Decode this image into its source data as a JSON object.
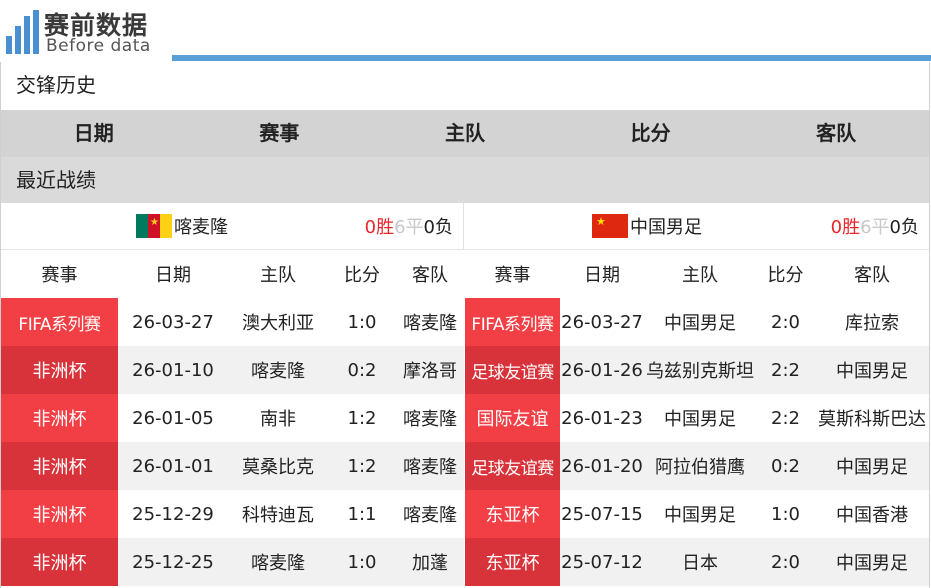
{
  "brand": {
    "title": "赛前数据",
    "subtitle": "Before data",
    "accent": "#5aa0d8"
  },
  "section_h2h": "交锋历史",
  "h2h_columns": [
    "日期",
    "赛事",
    "主队",
    "比分",
    "客队"
  ],
  "section_recent": "最近战绩",
  "left": {
    "team": "喀麦隆",
    "flag": "cameroon-flag",
    "record": {
      "w": "0胜",
      "d": "6平",
      "l": "0负"
    },
    "columns": [
      "赛事",
      "日期",
      "主队",
      "比分",
      "客队"
    ],
    "rows": [
      [
        "FIFA系列赛",
        "26-03-27",
        "澳大利亚",
        "1:0",
        "喀麦隆"
      ],
      [
        "非洲杯",
        "26-01-10",
        "喀麦隆",
        "0:2",
        "摩洛哥"
      ],
      [
        "非洲杯",
        "26-01-05",
        "南非",
        "1:2",
        "喀麦隆"
      ],
      [
        "非洲杯",
        "26-01-01",
        "莫桑比克",
        "1:2",
        "喀麦隆"
      ],
      [
        "非洲杯",
        "25-12-29",
        "科特迪瓦",
        "1:1",
        "喀麦隆"
      ],
      [
        "非洲杯",
        "25-12-25",
        "喀麦隆",
        "1:0",
        "加蓬"
      ]
    ]
  },
  "right": {
    "team": "中国男足",
    "flag": "china-flag",
    "record": {
      "w": "0胜",
      "d": "6平",
      "l": "0负"
    },
    "columns": [
      "赛事",
      "日期",
      "主队",
      "比分",
      "客队"
    ],
    "rows": [
      [
        "FIFA系列赛",
        "26-03-27",
        "中国男足",
        "2:0",
        "库拉索"
      ],
      [
        "足球友谊赛",
        "26-01-26",
        "乌兹别克斯坦",
        "2:2",
        "中国男足"
      ],
      [
        "国际友谊",
        "26-01-23",
        "中国男足",
        "2:2",
        "莫斯科斯巴达"
      ],
      [
        "足球友谊赛",
        "26-01-20",
        "阿拉伯猎鹰",
        "0:2",
        "中国男足"
      ],
      [
        "东亚杯",
        "25-07-15",
        "中国男足",
        "1:0",
        "中国香港"
      ],
      [
        "东亚杯",
        "25-07-12",
        "日本",
        "2:0",
        "中国男足"
      ]
    ]
  },
  "colors": {
    "competition_cell": "#f13f45",
    "competition_cell_alt": "#d8333a",
    "win": "#e8252b",
    "draw": "#c8c8c8"
  }
}
